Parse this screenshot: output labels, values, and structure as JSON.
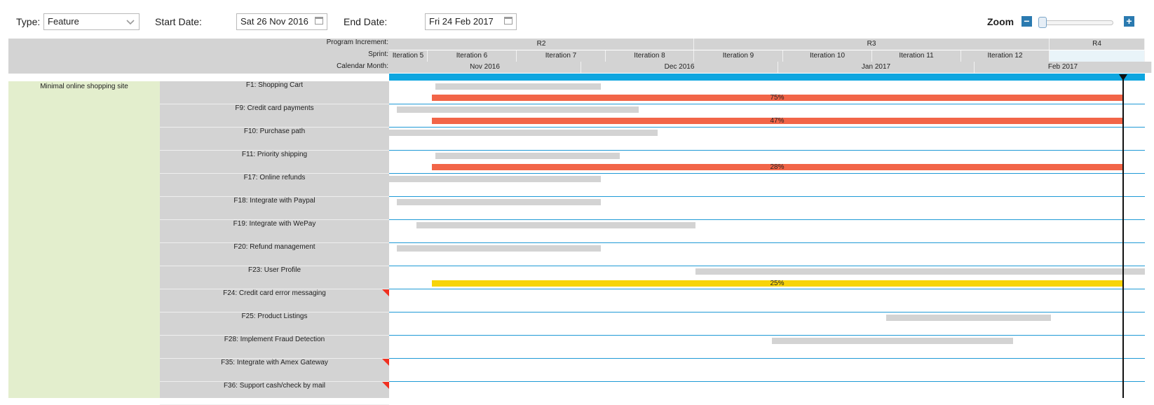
{
  "toolbar": {
    "type_label": "Type:",
    "type_value": "Feature",
    "start_label": "Start Date:",
    "start_value": "Sat 26 Nov 2016",
    "end_label": "End Date:",
    "end_value": "Fri 24 Feb 2017",
    "zoom_label": "Zoom",
    "zoom_minus": "−",
    "zoom_plus": "+",
    "zoom_level": 0.05
  },
  "header": {
    "pi_label": "Program Increment:",
    "sprint_label": "Sprint:",
    "month_label": "Calendar Month:",
    "program_increments": [
      "R2",
      "R3",
      "R4"
    ],
    "sprints": [
      "Iteration 5",
      "Iteration 6",
      "Iteration 7",
      "Iteration 8",
      "Iteration 9",
      "Iteration 10",
      "Iteration 11",
      "Iteration 12"
    ],
    "months": [
      "Nov 2016",
      "Dec 2016",
      "Jan 2017",
      "Feb 2017"
    ]
  },
  "group": {
    "label": "Minimal online shopping site"
  },
  "features": [
    {
      "label": "F1: Shopping Cart",
      "progress": "75%",
      "progress_color": "#f26548",
      "flag": false
    },
    {
      "label": "F9: Credit card payments",
      "progress": "47%",
      "progress_color": "#f26548",
      "flag": false
    },
    {
      "label": "F10: Purchase path",
      "progress": "",
      "progress_color": "",
      "flag": false
    },
    {
      "label": "F11: Priority shipping",
      "progress": "28%",
      "progress_color": "#f26548",
      "flag": false
    },
    {
      "label": "F17: Online refunds",
      "progress": "",
      "progress_color": "",
      "flag": false
    },
    {
      "label": "F18: Integrate with Paypal",
      "progress": "",
      "progress_color": "",
      "flag": false
    },
    {
      "label": "F19: Integrate with WePay",
      "progress": "",
      "progress_color": "",
      "flag": false
    },
    {
      "label": "F20: Refund management",
      "progress": "",
      "progress_color": "",
      "flag": false
    },
    {
      "label": "F23: User Profile",
      "progress": "25%",
      "progress_color": "#f7d40a",
      "flag": false
    },
    {
      "label": "F24: Credit card error messaging",
      "progress": "",
      "progress_color": "",
      "flag": true
    },
    {
      "label": "F25: Product Listings",
      "progress": "",
      "progress_color": "",
      "flag": false
    },
    {
      "label": "F28: Implement Fraud Detection",
      "progress": "",
      "progress_color": "",
      "flag": false
    },
    {
      "label": "F35: Integrate with Amex Gateway",
      "progress": "",
      "progress_color": "",
      "flag": true
    },
    {
      "label": "F36: Support cash/check by mail",
      "progress": "",
      "progress_color": "",
      "flag": true
    }
  ],
  "colors": {
    "accent_blue": "#0ea6e0",
    "row_line": "#1f9ad6",
    "group_bg": "#e3eecd",
    "header_bg": "#d3d3d3",
    "flag_red": "#f03020"
  }
}
